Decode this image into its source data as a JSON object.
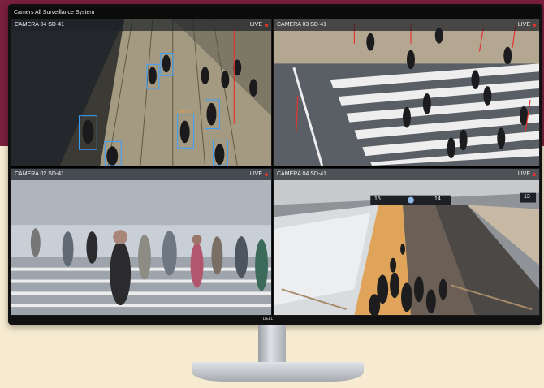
{
  "app": {
    "title": "Camers All Surveillance System"
  },
  "brand": {
    "logo_text": "DELL"
  },
  "feeds": [
    {
      "label": "CAMERA 04 SD-41",
      "live": "LIVE",
      "alert_tag": "ALERT"
    },
    {
      "label": "CAMERA 03 SD-41",
      "live": "LIVE"
    },
    {
      "label": "CAMERA 02 SD-41",
      "live": "LIVE"
    },
    {
      "label": "CAMERA 04 SD-41",
      "live": "LIVE",
      "platform_left": "15",
      "platform_right": "14",
      "platform_far": "13"
    }
  ],
  "colors": {
    "live_dot": "#e3342f",
    "detection_box": "#3aa0ff",
    "background_top": "#7a1f3d",
    "background_bottom": "#f6ead0"
  }
}
